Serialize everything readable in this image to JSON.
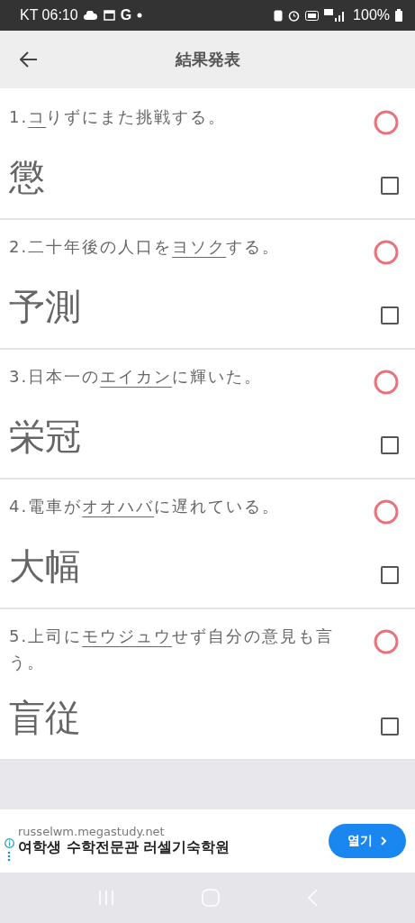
{
  "status_bar": {
    "carrier_time": "KT 06:10",
    "g": "G",
    "battery_text": "100%"
  },
  "app_bar": {
    "title": "結果発表"
  },
  "questions": [
    {
      "number": "1.",
      "target": "コ",
      "after": "りずにまた挑戦する。",
      "answer": "懲",
      "correct": true,
      "checked": false
    },
    {
      "number": "2.",
      "before": "二十年後の人口を",
      "target": "ヨソク",
      "after": "する。",
      "answer": "予測",
      "correct": true,
      "checked": false
    },
    {
      "number": "3.",
      "before": "日本一の",
      "target": "エイカン",
      "after": "に輝いた。",
      "answer": "栄冠",
      "correct": true,
      "checked": false
    },
    {
      "number": "4.",
      "before": "電車が",
      "target": "オオハバ",
      "after": "に遅れている。",
      "answer": "大幅",
      "correct": true,
      "checked": false
    },
    {
      "number": "5.",
      "before": "上司に",
      "target": "モウジュウ",
      "after": "せず自分の意見も言う。",
      "answer": "盲従",
      "correct": true,
      "checked": false
    }
  ],
  "ad": {
    "url": "russelwm.megastudy.net",
    "headline": "여학생 수학전문관 러셀기숙학원",
    "button": "열기"
  }
}
